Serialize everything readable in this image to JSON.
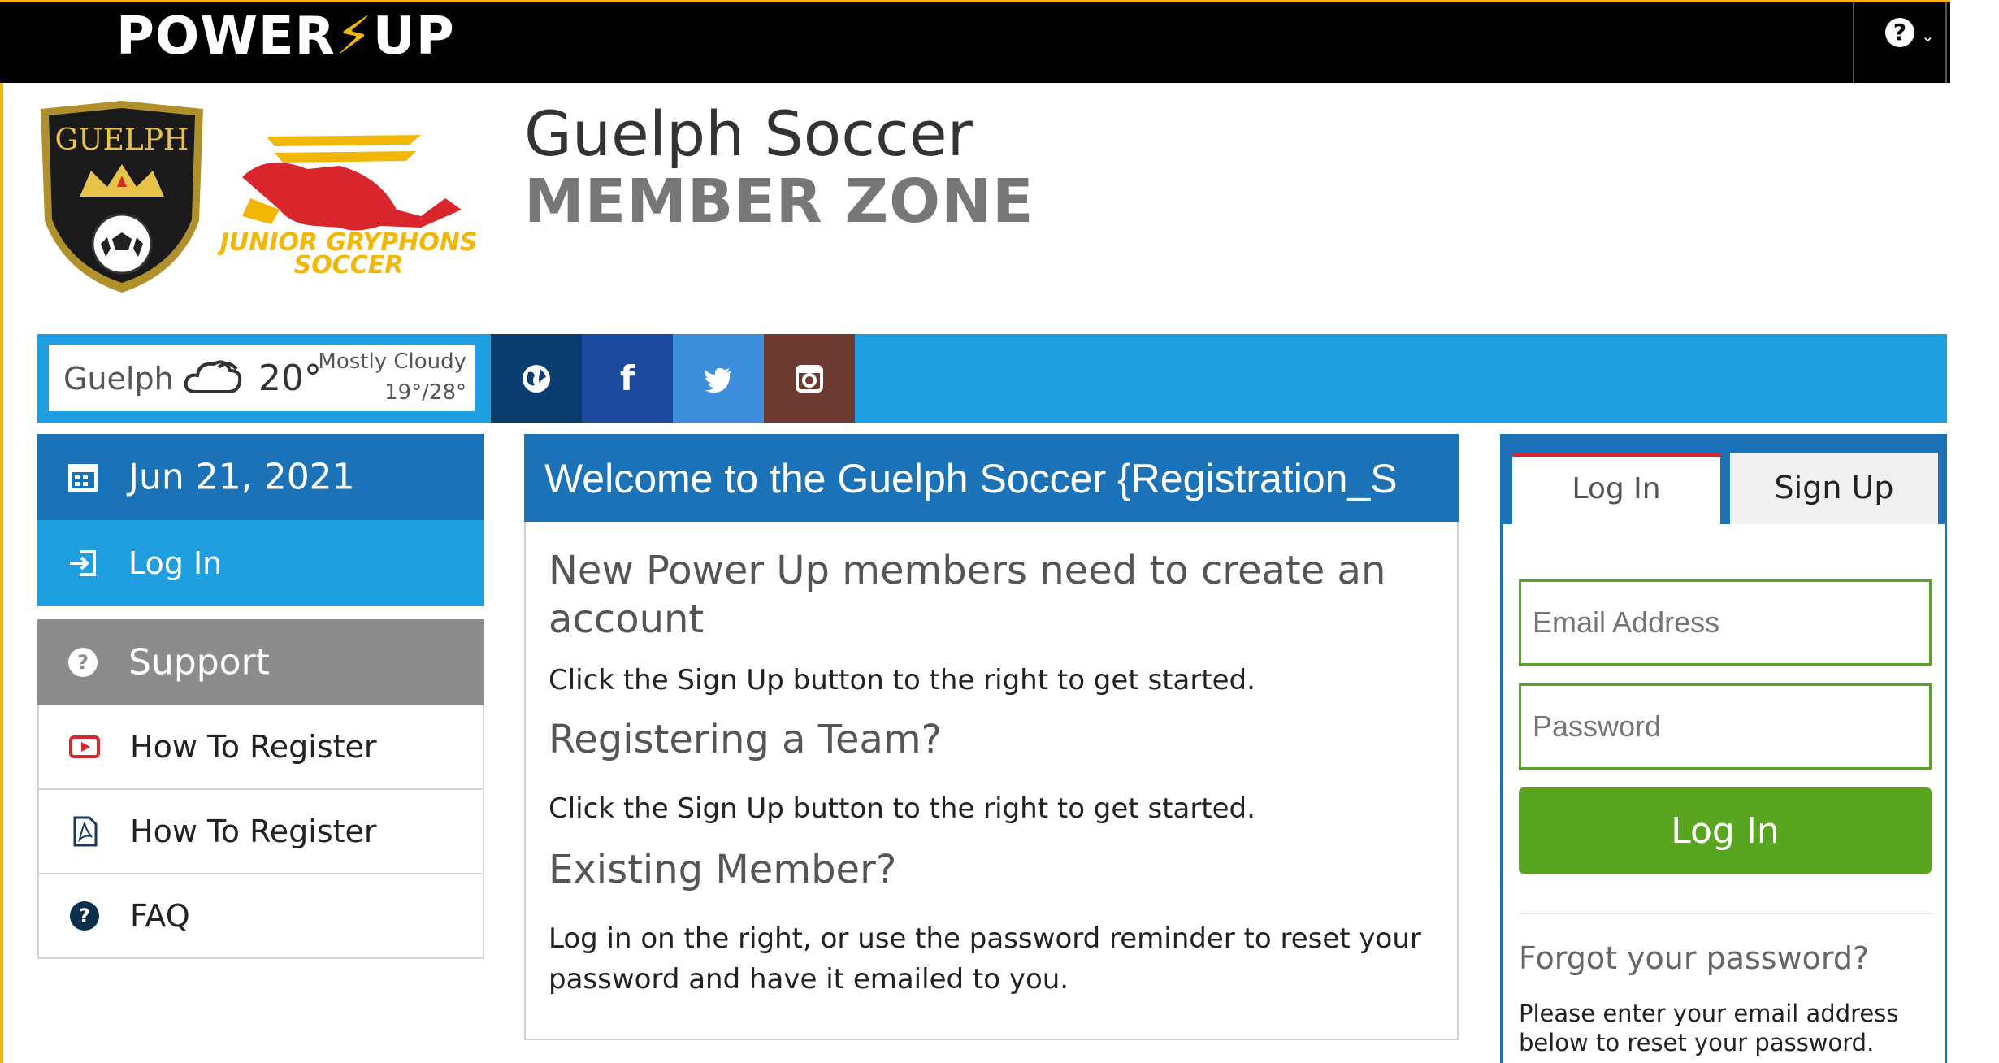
{
  "topbar": {
    "logo_left": "POWER",
    "logo_right": "UP",
    "help_icon": "question-icon"
  },
  "header": {
    "crest_text": "GUELPH",
    "gryphon_text1": "JUNIOR GRYPHONS",
    "gryphon_text2": "SOCCER",
    "title_line1": "Guelph Soccer",
    "title_line2": "MEMBER ZONE"
  },
  "weather": {
    "city": "Guelph",
    "temp": "20°",
    "condition": "Mostly Cloudy",
    "range": "19°/28°",
    "icon": "cloud-icon"
  },
  "social": [
    {
      "name": "globe-icon",
      "color": "#0b3d6e"
    },
    {
      "name": "facebook-icon",
      "color": "#1c4a9e"
    },
    {
      "name": "twitter-icon",
      "color": "#3d8fdb"
    },
    {
      "name": "instagram-icon",
      "color": "#6d3a31"
    }
  ],
  "sidebar": {
    "date": "Jun 21, 2021",
    "login": "Log In",
    "support": "Support",
    "items": [
      {
        "label": "How To Register",
        "icon": "video-icon"
      },
      {
        "label": "How To Register",
        "icon": "pdf-icon"
      },
      {
        "label": "FAQ",
        "icon": "question-icon"
      }
    ]
  },
  "welcome": {
    "heading": "Welcome to the Guelph Soccer {Registration_S",
    "h1": "New Power Up members need to create an account",
    "p1": "Click the Sign Up button to the right to get started.",
    "h2": "Registering a Team?",
    "p2": "Click the Sign Up button to the right to get started.",
    "h3": "Existing Member?",
    "p3": "Log in on the right, or use the password reminder to reset your password and have it emailed to you."
  },
  "auth": {
    "tab_login": "Log In",
    "tab_signup": "Sign Up",
    "email_placeholder": "Email Address",
    "password_placeholder": "Password",
    "login_button": "Log In",
    "forgot_title": "Forgot your password?",
    "forgot_desc": "Please enter your email address below to reset your password."
  },
  "colors": {
    "accent_yellow": "#f2b705",
    "band_blue": "#1f9ee0",
    "dark_blue": "#1b72b6",
    "green": "#5aa51f",
    "red_tab": "#d9262c"
  }
}
